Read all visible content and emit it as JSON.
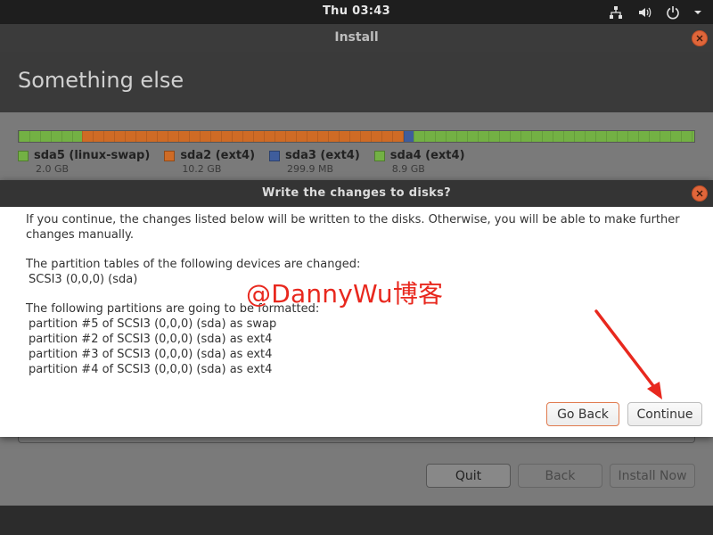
{
  "topbar": {
    "clock": "Thu 03:43",
    "tray_icons": [
      "network-icon",
      "volume-icon",
      "power-icon",
      "chevron-down-icon"
    ]
  },
  "window": {
    "title": "Install",
    "close_icon": "close-icon"
  },
  "page": {
    "heading": "Something else"
  },
  "disk": {
    "segments": [
      {
        "name": "sda5 (linux-swap)",
        "size": "2.0 GB",
        "color": "#73b144",
        "fraction": 0.0935
      },
      {
        "name": "sda2 (ext4)",
        "size": "10.2 GB",
        "color": "#cf6b25",
        "fraction": 0.4765
      },
      {
        "name": "sda3 (ext4)",
        "size": "299.9 MB",
        "color": "#3f5d9c",
        "fraction": 0.014
      },
      {
        "name": "sda4 (ext4)",
        "size": "8.9 GB",
        "color": "#73b144",
        "fraction": 0.416
      }
    ]
  },
  "dialog": {
    "title": "Write the changes to disks?",
    "para1": "If you continue, the changes listed below will be written to the disks. Otherwise, you will be able to make further changes manually.",
    "para2_heading": "The partition tables of the following devices are changed:",
    "para2_items": [
      "SCSI3 (0,0,0) (sda)"
    ],
    "para3_heading": "The following partitions are going to be formatted:",
    "para3_items": [
      "partition #5 of SCSI3 (0,0,0) (sda) as swap",
      "partition #2 of SCSI3 (0,0,0) (sda) as ext4",
      "partition #3 of SCSI3 (0,0,0) (sda) as ext4",
      "partition #4 of SCSI3 (0,0,0) (sda) as ext4"
    ],
    "go_back_label": "Go Back",
    "continue_label": "Continue"
  },
  "watermark": "@DannyWu博客",
  "footer_buttons": {
    "quit": "Quit",
    "back": "Back",
    "install_now": "Install Now"
  },
  "colors": {
    "accent_close": "#e0663a",
    "arrow": "#e8281e"
  }
}
